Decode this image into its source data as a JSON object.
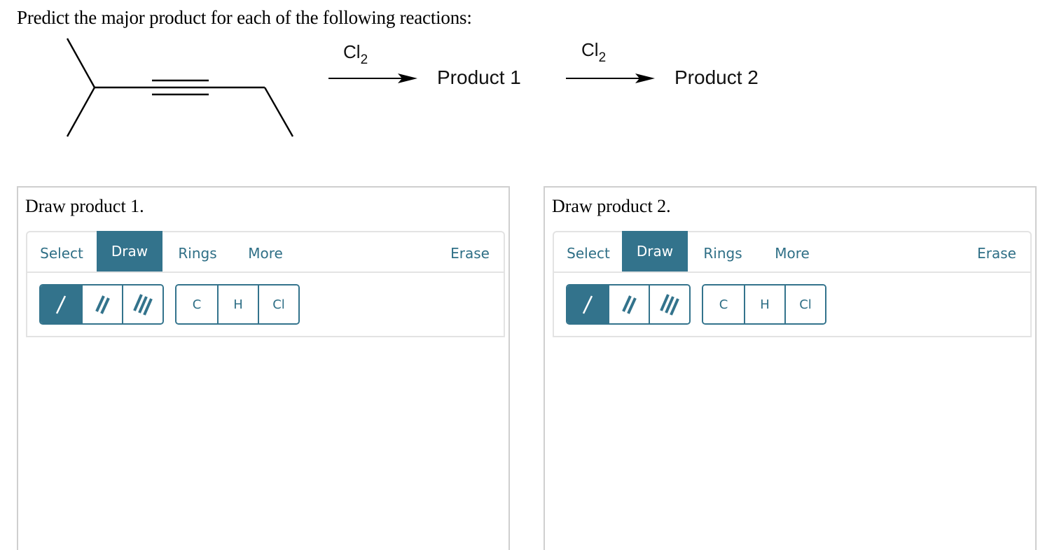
{
  "question": "Predict the major product for each of the following reactions:",
  "scheme": {
    "reagent_1": {
      "main": "Cl",
      "sub": "2"
    },
    "product_1_label": "Product 1",
    "reagent_2": {
      "main": "Cl",
      "sub": "2"
    },
    "product_2_label": "Product 2",
    "starting_material": "2-methylhex-3-yne (skeletal structure)"
  },
  "panels": [
    {
      "title": "Draw product 1.",
      "tabs": [
        {
          "label": "Select",
          "active": false
        },
        {
          "label": "Draw",
          "active": true
        },
        {
          "label": "Rings",
          "active": false
        },
        {
          "label": "More",
          "active": false
        }
      ],
      "erase_label": "Erase",
      "bond_tools": [
        {
          "name": "single-bond",
          "active": true
        },
        {
          "name": "double-bond",
          "active": false
        },
        {
          "name": "triple-bond",
          "active": false
        }
      ],
      "atoms": [
        "C",
        "H",
        "Cl"
      ]
    },
    {
      "title": "Draw product 2.",
      "tabs": [
        {
          "label": "Select",
          "active": false
        },
        {
          "label": "Draw",
          "active": true
        },
        {
          "label": "Rings",
          "active": false
        },
        {
          "label": "More",
          "active": false
        }
      ],
      "erase_label": "Erase",
      "bond_tools": [
        {
          "name": "single-bond",
          "active": true
        },
        {
          "name": "double-bond",
          "active": false
        },
        {
          "name": "triple-bond",
          "active": false
        }
      ],
      "atoms": [
        "C",
        "H",
        "Cl"
      ]
    }
  ],
  "colors": {
    "accent": "#33738c",
    "accent_text": "#2f6f86",
    "border": "#cfcfcf",
    "toolbar_border": "#e3e3e3"
  }
}
